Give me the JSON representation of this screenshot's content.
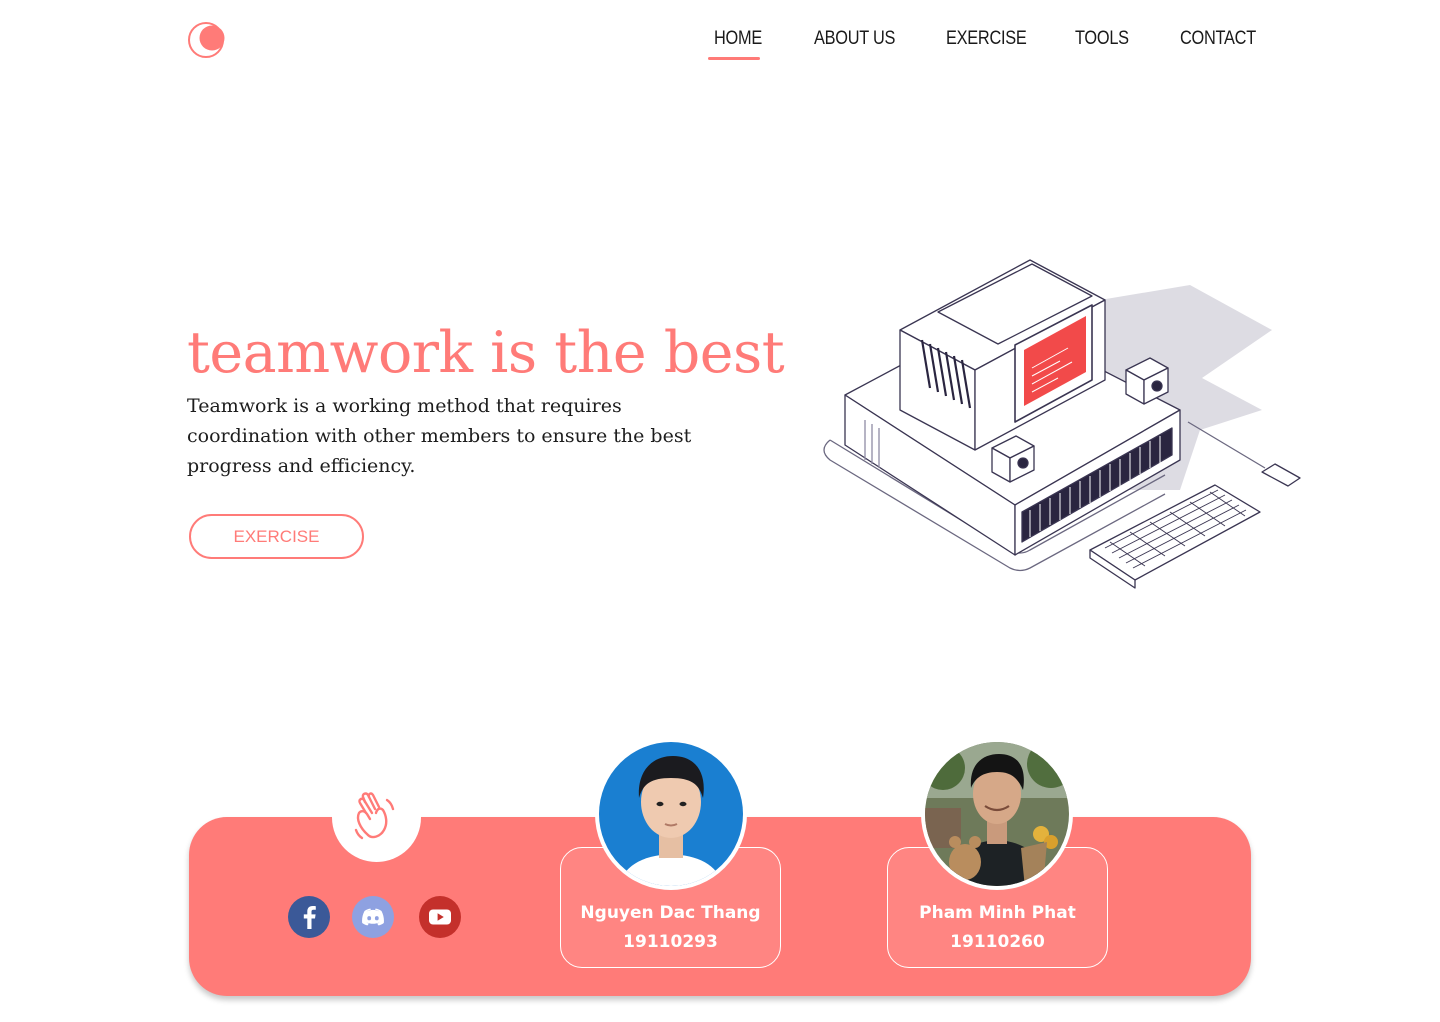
{
  "nav": {
    "items": [
      {
        "label": "HOME",
        "active": true
      },
      {
        "label": "ABOUT US"
      },
      {
        "label": "EXERCISE"
      },
      {
        "label": "TOOLS"
      },
      {
        "label": "CONTACT"
      }
    ]
  },
  "hero": {
    "title": "teamwork is the best",
    "description": "Teamwork is a working method that requires coordination with other members to ensure the best progress and efficiency.",
    "button_label": "EXERCISE"
  },
  "team": {
    "badge_icon": "waving-hand-icon",
    "socials": [
      {
        "name": "facebook-icon",
        "color": "#3b5998"
      },
      {
        "name": "discord-icon",
        "color": "#8ea1e1"
      },
      {
        "name": "youtube-icon",
        "color": "#c4302b"
      }
    ],
    "members": [
      {
        "name": "Nguyen Dac Thang",
        "id": "19110293"
      },
      {
        "name": "Pham Minh Phat",
        "id": "19110260"
      }
    ]
  },
  "colors": {
    "accent": "#ff7b78",
    "text": "#1d1d1d",
    "background": "#ffffff"
  }
}
